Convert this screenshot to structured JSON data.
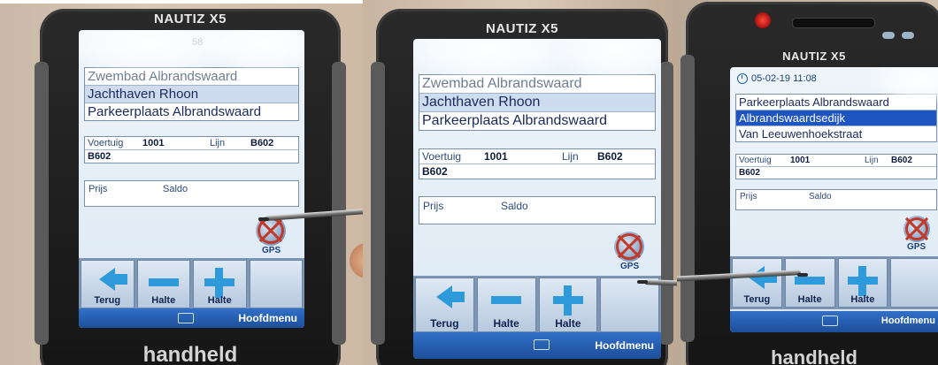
{
  "photos": [
    {
      "brand": "NAUTIZ X5",
      "maker": "handheld",
      "partial_status": "58",
      "stops": [
        "Zwembad Albrandswaard",
        "Jachthaven Rhoon",
        "Parkeerplaats Albrandswaard"
      ],
      "voertuig_label": "Voertuig",
      "voertuig_value": "1001",
      "lijn_label": "Lijn",
      "lijn_value": "B602",
      "route_value": "B602",
      "prijs_label": "Prijs",
      "saldo_label": "Saldo",
      "gps_label": "GPS",
      "buttons": [
        "Terug",
        "Halte",
        "Halte",
        ""
      ],
      "menu_label": "Hoofdmenu"
    },
    {
      "brand": "NAUTIZ X5",
      "stops": [
        "Zwembad Albrandswaard",
        "Jachthaven Rhoon",
        "Parkeerplaats Albrandswaard"
      ],
      "voertuig_label": "Voertuig",
      "voertuig_value": "1001",
      "lijn_label": "Lijn",
      "lijn_value": "B602",
      "route_value": "B602",
      "prijs_label": "Prijs",
      "saldo_label": "Saldo",
      "gps_label": "GPS",
      "buttons": [
        "Terug",
        "Halte",
        "Halte",
        ""
      ],
      "menu_label": "Hoofdmenu"
    },
    {
      "brand": "NAUTIZ X5",
      "maker": "handheld",
      "datetime": "05-02-19 11:08",
      "stops": [
        "Parkeerplaats Albrandswaard",
        "Albrandswaardsedijk",
        "Van Leeuwenhoekstraat"
      ],
      "voertuig_label": "Voertuig",
      "voertuig_value": "1001",
      "lijn_label": "Lijn",
      "lijn_value": "B602",
      "route_value": "B602",
      "prijs_label": "Prijs",
      "saldo_label": "Saldo",
      "gps_label": "GPS",
      "buttons": [
        "Terug",
        "Halte",
        "Halte",
        ""
      ],
      "menu_label": "Hoofdmenu"
    }
  ]
}
